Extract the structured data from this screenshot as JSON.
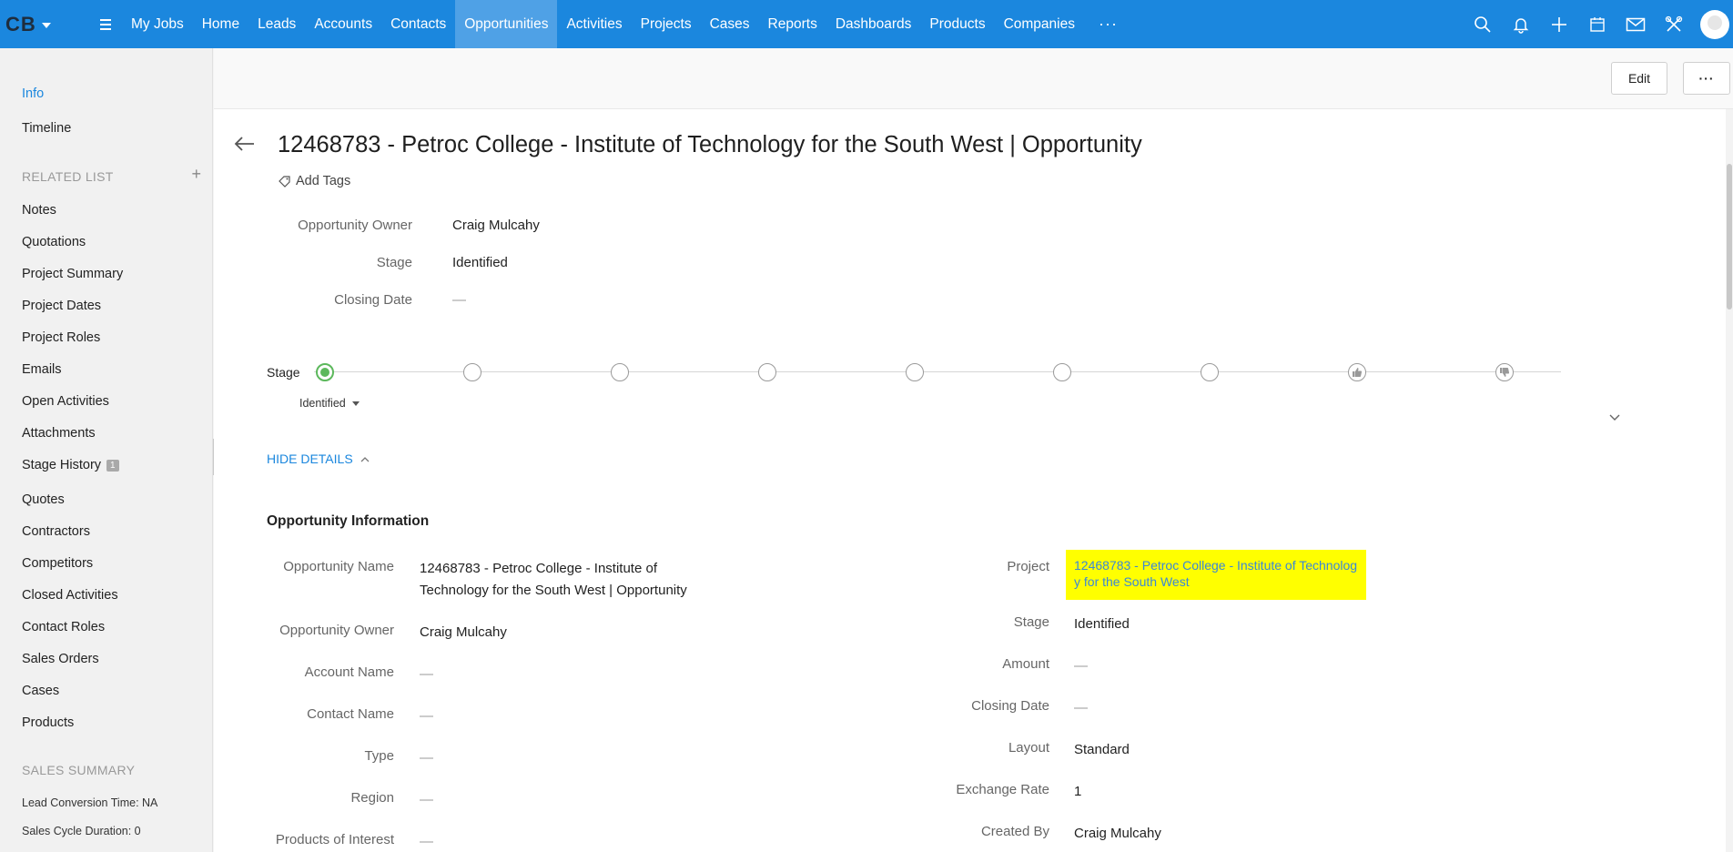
{
  "brand": {
    "logo_text": "CB"
  },
  "nav": {
    "items": [
      "My Jobs",
      "Home",
      "Leads",
      "Accounts",
      "Contacts",
      "Opportunities",
      "Activities",
      "Projects",
      "Cases",
      "Reports",
      "Dashboards",
      "Products",
      "Companies"
    ],
    "active": "Opportunities",
    "more_label": "···",
    "right_icons": [
      "search-icon",
      "bell-icon",
      "plus-icon",
      "calendar-icon",
      "mail-icon",
      "tools-icon",
      "avatar"
    ]
  },
  "sidebar": {
    "info": "Info",
    "timeline": "Timeline",
    "related_title": "RELATED LIST",
    "related_plus": "+",
    "related": [
      "Notes",
      "Quotations",
      "Project Summary",
      "Project Dates",
      "Project Roles",
      "Emails",
      "Open Activities",
      "Attachments",
      "Stage History",
      "Quotes",
      "Contractors",
      "Competitors",
      "Closed Activities",
      "Contact Roles",
      "Sales Orders",
      "Cases",
      "Products"
    ],
    "stage_history_badge": "1",
    "sales_title": "SALES SUMMARY",
    "lead_conversion": "Lead Conversion Time: NA",
    "sales_cycle": "Sales Cycle Duration: 0"
  },
  "toolbar": {
    "edit_label": "Edit",
    "more_label": "···"
  },
  "record": {
    "title": "12468783 - Petroc College - Institute of Technology for the South West | Opportunity",
    "add_tags": "Add Tags"
  },
  "summary": [
    {
      "label": "Opportunity Owner",
      "value": "Craig Mulcahy"
    },
    {
      "label": "Stage",
      "value": "Identified"
    },
    {
      "label": "Closing Date",
      "value": "—"
    }
  ],
  "stage": {
    "label": "Stage",
    "current": "Identified",
    "steps": 9,
    "completed": 1
  },
  "details": {
    "hide_label": "HIDE DETAILS",
    "section_title": "Opportunity Information",
    "left": [
      {
        "label": "Opportunity Name",
        "value": "12468783 - Petroc College - Institute of Technology for the South West | Opportunity"
      },
      {
        "label": "Opportunity Owner",
        "value": "Craig Mulcahy"
      },
      {
        "label": "Account Name",
        "value": "—"
      },
      {
        "label": "Contact Name",
        "value": "—"
      },
      {
        "label": "Type",
        "value": "—"
      },
      {
        "label": "Region",
        "value": "—"
      },
      {
        "label": "Products of Interest",
        "value": "—"
      }
    ],
    "right": [
      {
        "label": "Project",
        "value": "12468783 - Petroc College - Institute of Technology for the South West"
      },
      {
        "label": "Stage",
        "value": "Identified"
      },
      {
        "label": "Amount",
        "value": "—"
      },
      {
        "label": "Closing Date",
        "value": "—"
      },
      {
        "label": "Layout",
        "value": "Standard"
      },
      {
        "label": "Exchange Rate",
        "value": "1"
      },
      {
        "label": "Created By",
        "value": "Craig Mulcahy"
      }
    ]
  },
  "colors": {
    "nav_bg": "#1b87de",
    "nav_active": "#4fa1e6",
    "link": "#1b87de",
    "highlight": "#ffff00",
    "stage_done": "#5cb85c"
  }
}
